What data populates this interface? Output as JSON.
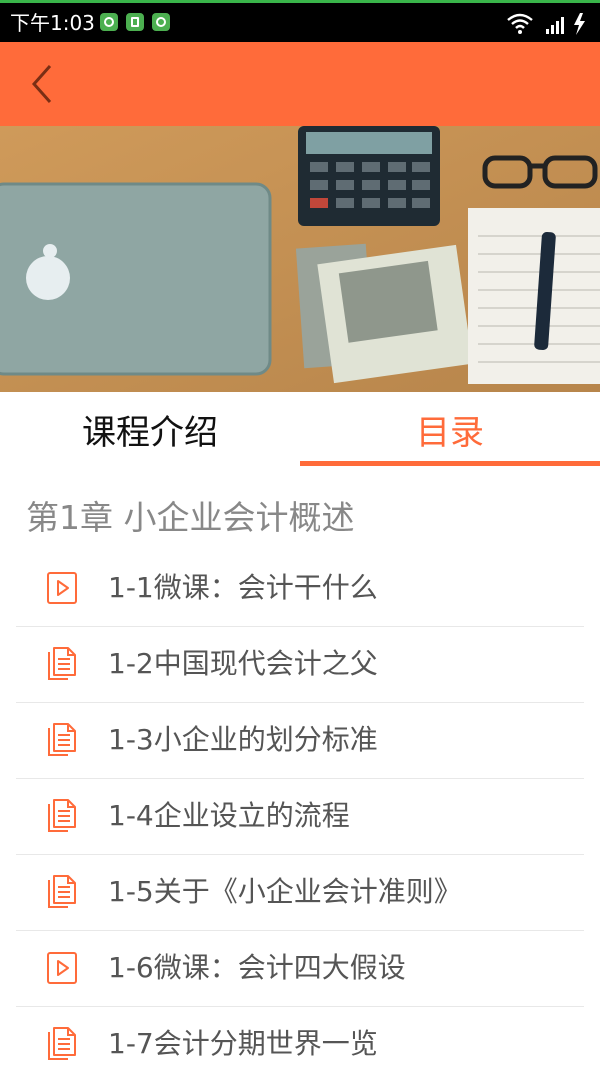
{
  "status_bar": {
    "time": "下午1:03"
  },
  "app_bar": {
    "back_icon": "chevron-left-icon",
    "color": "#ff6b3a"
  },
  "tabs": [
    {
      "label": "课程介绍",
      "active": false
    },
    {
      "label": "目录",
      "active": true
    }
  ],
  "chapter": {
    "title": "第1章 小企业会计概述",
    "lessons": [
      {
        "label": "1-1微课：会计干什么",
        "icon": "video-play-icon"
      },
      {
        "label": "1-2中国现代会计之父",
        "icon": "document-icon"
      },
      {
        "label": "1-3小企业的划分标准",
        "icon": "document-icon"
      },
      {
        "label": "1-4企业设立的流程",
        "icon": "document-icon"
      },
      {
        "label": "1-5关于《小企业会计准则》",
        "icon": "document-icon"
      },
      {
        "label": "1-6微课：会计四大假设",
        "icon": "video-play-icon"
      },
      {
        "label": "1-7会计分期世界一览",
        "icon": "document-icon"
      }
    ]
  },
  "colors": {
    "accent": "#ff6b3a",
    "text_secondary": "#555555",
    "chapter_text": "#888888"
  }
}
